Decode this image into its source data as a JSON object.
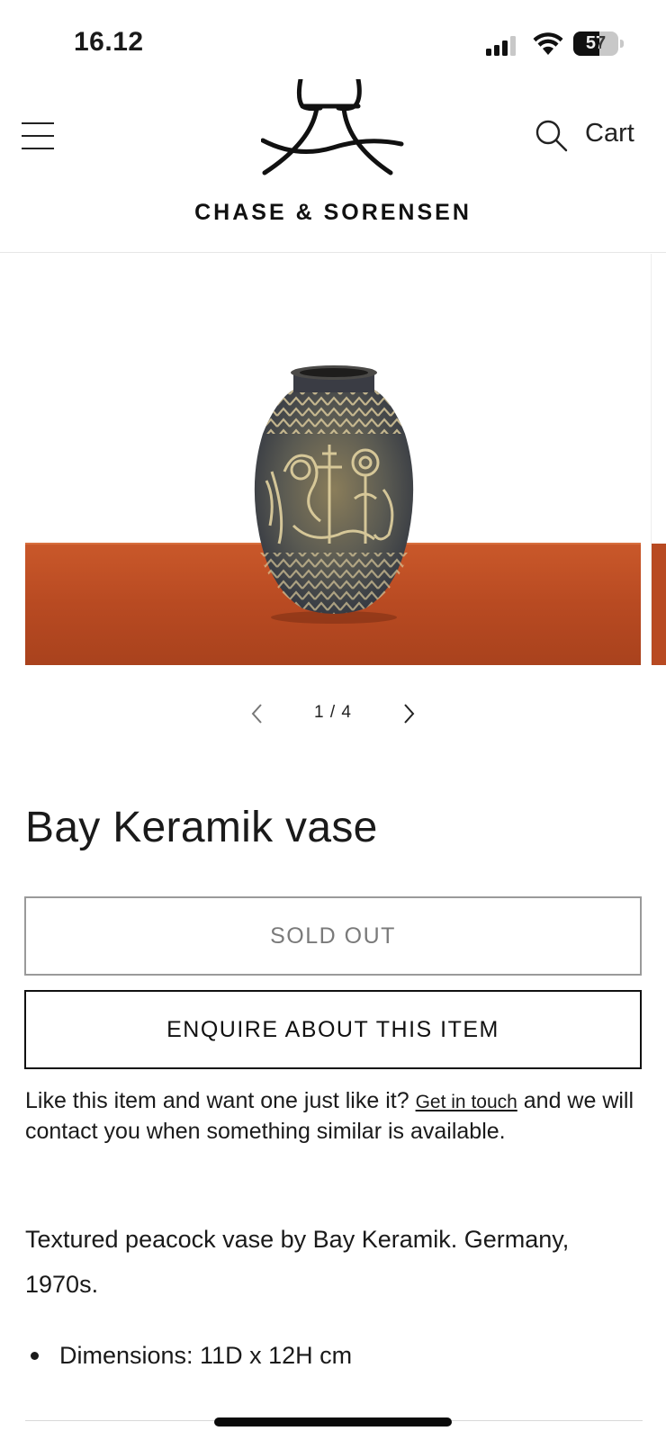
{
  "status_bar": {
    "time": "16.12",
    "battery_level": "57",
    "battery_fraction": 0.57
  },
  "header": {
    "brand_name": "CHASE & SORENSEN",
    "cart_label": "Cart",
    "menu_icon": "hamburger-menu-icon",
    "search_icon": "search-icon"
  },
  "gallery": {
    "counter": "1 / 4",
    "prev_icon": "chevron-left-icon",
    "next_icon": "chevron-right-icon"
  },
  "product": {
    "title": "Bay Keramik vase",
    "sold_out_label": "SOLD OUT",
    "enquire_label": "ENQUIRE ABOUT THIS ITEM",
    "similar_prefix": "Like this item and want one just like it?",
    "similar_link": "Get in touch",
    "similar_suffix": "and we will contact you when something similar is available.",
    "description": "Textured peacock vase by Bay Keramik. Germany, 1970s.",
    "specs": [
      "Dimensions: 11D x 12H cm"
    ]
  },
  "colors": {
    "table_wood": "#b84a22",
    "text": "#1a1a1a",
    "sold_out_border": "#9a9a9a"
  }
}
